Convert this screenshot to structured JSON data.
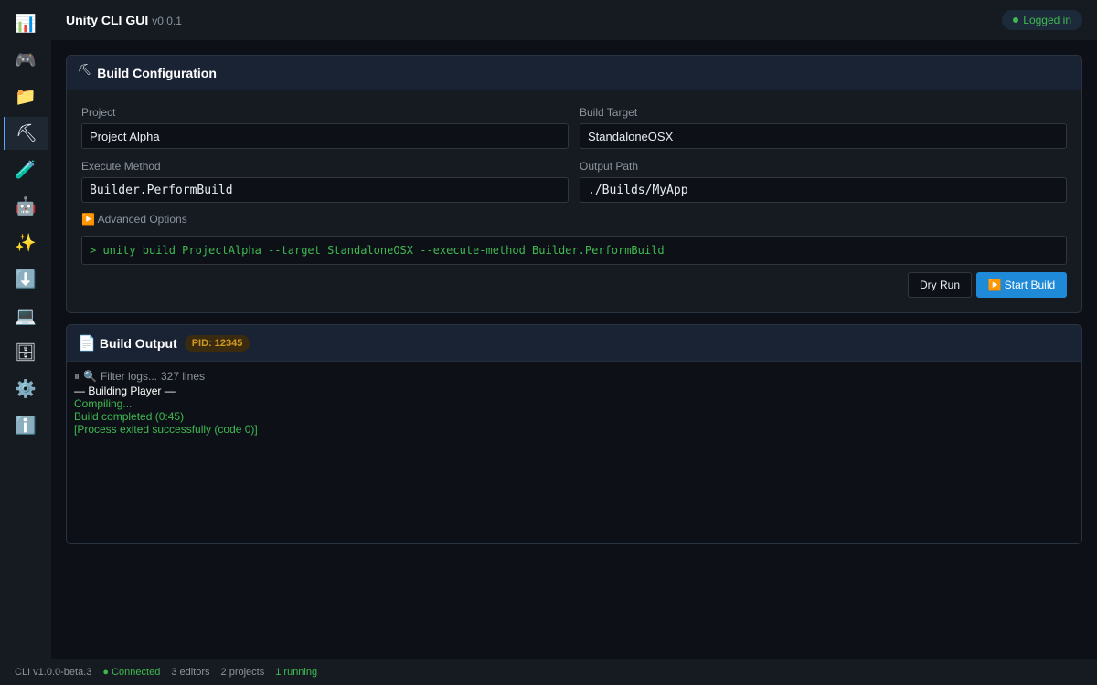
{
  "sidebar": {
    "items": [
      {
        "name": "dashboard",
        "icon": "📊"
      },
      {
        "name": "editors",
        "icon": "🎮"
      },
      {
        "name": "projects",
        "icon": "📁"
      },
      {
        "name": "build",
        "icon": "⛏",
        "active": true
      },
      {
        "name": "test",
        "icon": "🧪"
      },
      {
        "name": "ai",
        "icon": "🤖"
      },
      {
        "name": "generate",
        "icon": "✨"
      },
      {
        "name": "install",
        "icon": "⬇️"
      },
      {
        "name": "terminal",
        "icon": "💻"
      },
      {
        "name": "packages",
        "icon": "🗄"
      },
      {
        "name": "settings",
        "icon": "⚙️"
      },
      {
        "name": "info",
        "icon": "ℹ️"
      }
    ]
  },
  "header": {
    "title": "Unity CLI GUI",
    "version": "v0.0.1",
    "login_status": "Logged in"
  },
  "build_config": {
    "icon": "⛏",
    "title": "Build Configuration",
    "project_label": "Project",
    "project_value": "Project Alpha",
    "target_label": "Build Target",
    "target_value": "StandaloneOSX",
    "method_label": "Execute Method",
    "method_value": "Builder.PerformBuild",
    "output_label": "Output Path",
    "output_value": "./Builds/MyApp",
    "advanced_icon": "▶️",
    "advanced_label": "Advanced Options",
    "command_preview": "> unity build ProjectAlpha --target StandaloneOSX --execute-method Builder.PerformBuild",
    "dry_run_label": "Dry Run",
    "start_icon": "▶️",
    "start_label": "Start Build"
  },
  "build_output": {
    "icon": "📄",
    "title": "Build Output",
    "pid": "PID: 12345",
    "pause_icon": "⏸",
    "search_icon": "🔍",
    "filter_placeholder": "Filter logs...",
    "line_count": "327 lines",
    "lines": [
      {
        "text": "— Building Player —",
        "color": "white"
      },
      {
        "text": "Compiling...",
        "color": "green"
      },
      {
        "text": "Build completed (0:45)",
        "color": "green"
      },
      {
        "text": "[Process exited successfully (code 0)]",
        "color": "green"
      }
    ]
  },
  "status_bar": {
    "cli_version": "CLI v1.0.0-beta.3",
    "connection": "Connected",
    "editors": "3 editors",
    "projects": "2 projects",
    "running": "1 running"
  },
  "colors": {
    "background": "#0d1117",
    "panel": "#161b22",
    "accent": "#1f8ad8",
    "success": "#3fb950",
    "warning": "#d29922"
  }
}
